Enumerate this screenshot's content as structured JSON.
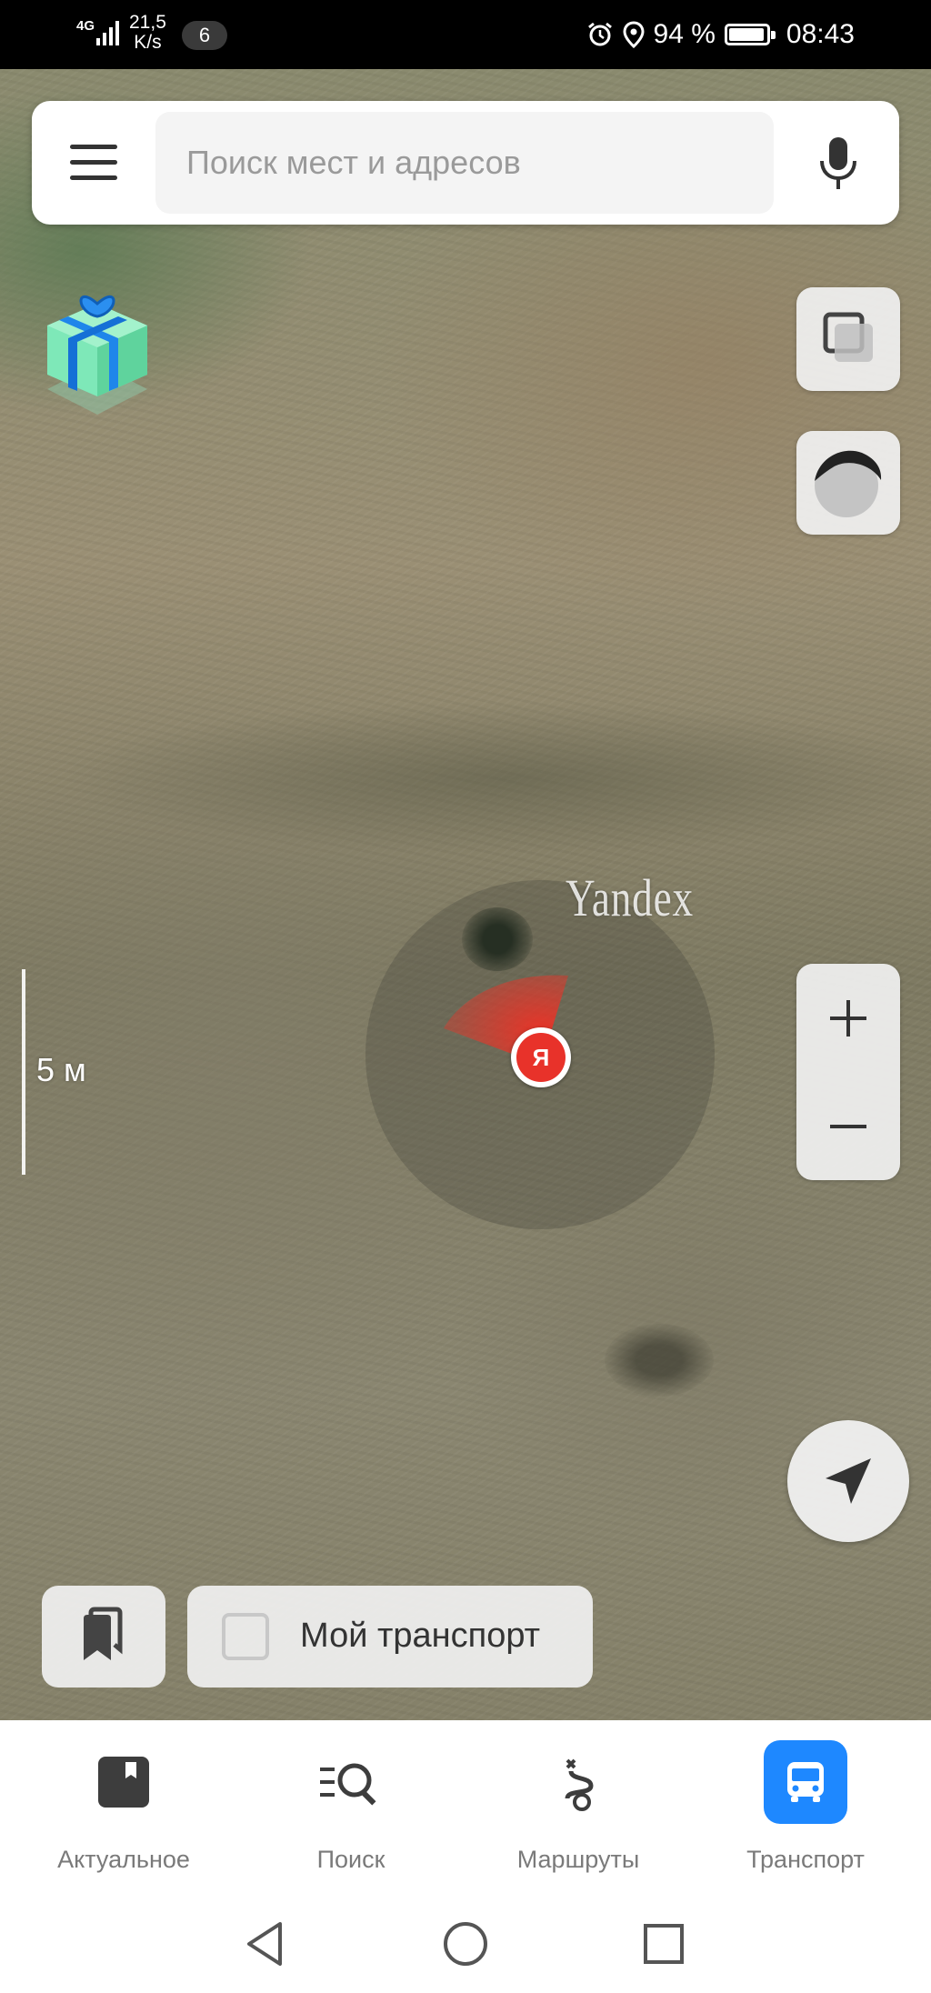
{
  "status_bar": {
    "network": "4G",
    "speed_value": "21,5",
    "speed_unit": "K/s",
    "notifications_count": "6",
    "battery_percent": "94 %",
    "battery_level": 0.94,
    "time": "08:43"
  },
  "search": {
    "placeholder": "Поиск мест и адресов"
  },
  "map": {
    "watermark": "Yandex",
    "scale_label": "5 м",
    "me_marker_label": "Я"
  },
  "bottom_controls": {
    "my_transport_label": "Мой транспорт"
  },
  "tabs": [
    {
      "label": "Актуальное",
      "icon": "news-icon",
      "active": false
    },
    {
      "label": "Поиск",
      "icon": "search-list-icon",
      "active": false
    },
    {
      "label": "Маршруты",
      "icon": "route-icon",
      "active": false
    },
    {
      "label": "Транспорт",
      "icon": "bus-icon",
      "active": true
    }
  ],
  "colors": {
    "accent": "#1e88ff",
    "me_marker": "#e8322a"
  }
}
